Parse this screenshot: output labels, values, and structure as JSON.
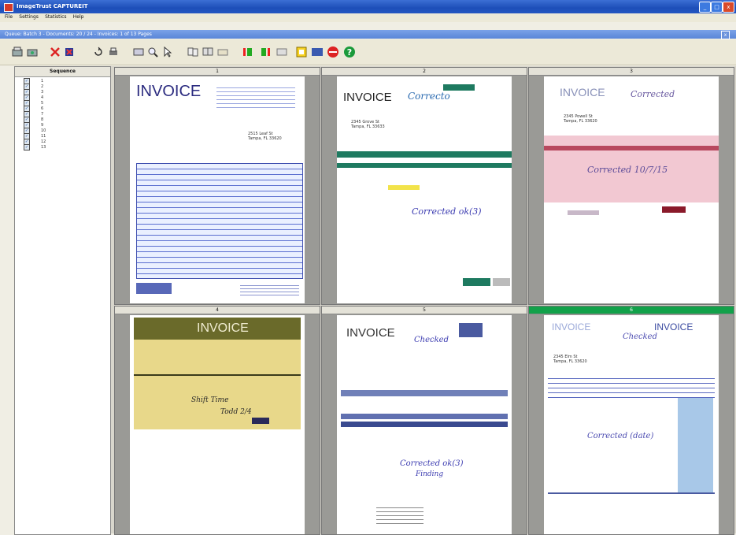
{
  "window": {
    "title": "ImageTrust CAPTUREIT",
    "min": "_",
    "max": "□",
    "close": "x"
  },
  "menu": [
    "File",
    "Settings",
    "Statistics",
    "Help"
  ],
  "document_bar": {
    "text": "Queue: Batch 3 - Documents: 20 / 24 - Invoices: 1 of 13 Pages",
    "close": "x"
  },
  "toolbar_icons": [
    "scan-icon",
    "rescan-icon",
    "delete-icon",
    "flag-icon",
    "rotate-icon",
    "print-icon",
    "zoom-fit-icon",
    "zoom-in-icon",
    "pointer-icon",
    "select-pages-icon",
    "merge-icon",
    "split-icon",
    "move-left-icon",
    "move-right-icon",
    "index-icon",
    "batch-icon",
    "stop-icon",
    "help-icon"
  ],
  "sequence": {
    "header": "Sequence",
    "items": [
      "1",
      "2",
      "3",
      "4",
      "5",
      "6",
      "7",
      "8",
      "9",
      "10",
      "11",
      "12",
      "13"
    ]
  },
  "thumbnails": [
    {
      "header": "1",
      "title": "INVOICE",
      "address": [
        "2515 Leaf St",
        "Tampa, FL 33620"
      ],
      "selected": false
    },
    {
      "header": "2",
      "title": "INVOICE",
      "handwriting": [
        "Correcto",
        "Corrected ok(3)"
      ],
      "address": [
        "2345 Grove St",
        "Tampa, FL 33633"
      ],
      "selected": false
    },
    {
      "header": "3",
      "title": "INVOICE",
      "handwriting": [
        "Corrected",
        "Corrected 10/7/15"
      ],
      "address": [
        "2345 Powell St",
        "Tampa, FL 33620"
      ],
      "selected": false
    },
    {
      "header": "4",
      "title": "INVOICE",
      "handwriting": [
        "Shift Time",
        "Todd 2/4"
      ],
      "selected": false
    },
    {
      "header": "5",
      "title": "INVOICE",
      "handwriting": [
        "Checked",
        "Corrected ok(3)",
        "Finding"
      ],
      "selected": false
    },
    {
      "header": "6",
      "title": "INVOICE",
      "handwriting": [
        "Checked",
        "Corrected (date)"
      ],
      "address": [
        "2345 Elm St",
        "Tampa, FL 33620"
      ],
      "selected": true
    }
  ],
  "colors": {
    "titlebar": "#1d4eb8",
    "selected_header": "#12a14a"
  }
}
